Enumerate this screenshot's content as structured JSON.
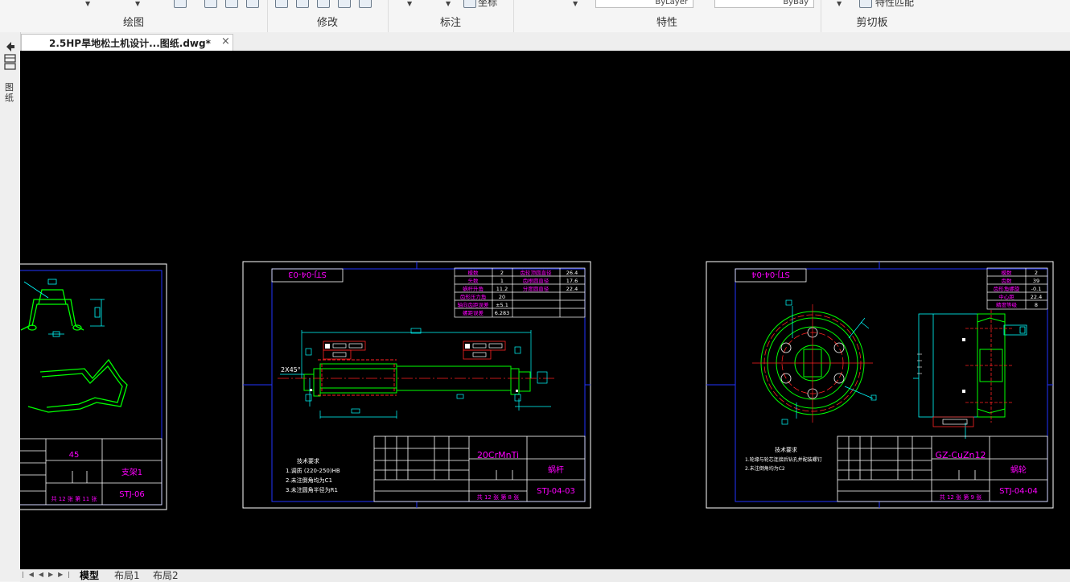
{
  "ribbon": {
    "groups": [
      {
        "label": "绘图"
      },
      {
        "label": "修改"
      },
      {
        "label": "标注"
      },
      {
        "label": "特性"
      },
      {
        "label": "剪切板"
      }
    ],
    "annotate_partial": "坐标",
    "property_values": [
      "ByLayer",
      "ByBay"
    ],
    "match_properties_label": "特性匹配"
  },
  "document_tab": {
    "title": "2.5HP旱地松土机设计...图纸.dwg*",
    "close_symbol": "×"
  },
  "left_panel": {
    "label": "图纸"
  },
  "layout_tabs": [
    {
      "label": "模型",
      "active": true
    },
    {
      "label": "布局1",
      "active": false
    },
    {
      "label": "布局2",
      "active": false
    }
  ],
  "drawing1": {
    "vertical_label": "STJ-04-03",
    "params": [
      [
        "模数",
        "2",
        "齿轮顶圆直径",
        "26.4"
      ],
      [
        "头数",
        "1",
        "齿根圆直径",
        "17.6"
      ],
      [
        "蜗杆升角",
        "11.2",
        "分度圆直径",
        "22.4"
      ],
      [
        "齿形压力角",
        "20",
        "",
        ""
      ],
      [
        "轴向齿距误差",
        "±5.1",
        "",
        ""
      ],
      [
        "螺距误差",
        "6.283",
        "",
        ""
      ]
    ],
    "chamfer": "2X45°",
    "notes_title": "技术要求",
    "notes": [
      "1.调质 (220-250)HB",
      "2.未注倒角均为C1",
      "3.未注圆角半径为R1"
    ],
    "material": "20CrMnTi",
    "part_name": "蜗杆",
    "code": "STJ-04-03",
    "sheet": "共 12 张 第 8 张"
  },
  "drawing2": {
    "vertical_label": "STJ-04-04",
    "params": [
      [
        "模数",
        "2"
      ],
      [
        "齿数",
        "39"
      ],
      [
        "齿形角螺旋",
        "-0.1"
      ],
      [
        "中心距",
        "22.4"
      ],
      [
        "精度等级",
        "8"
      ]
    ],
    "notes_title": "技术要求",
    "notes": [
      "1.轮缘与轮芯连接后钻孔并配装螺钉",
      "2.未注倒角均为C2"
    ],
    "material": "GZ-CuZn12",
    "part_name": "蜗轮",
    "code": "STJ-04-04",
    "sheet": "共 12 张 第 9 张"
  },
  "drawing3": {
    "value": "45",
    "part_name": "支架1",
    "code": "STJ-06",
    "sheet": "共 12 张 第 11 张"
  },
  "colors": {
    "canvas": "#000000",
    "title": "#ff00ff",
    "dim": "#00ffff",
    "frame": "#ffffff",
    "inner_frame": "#0000ff",
    "part": "#00ff00",
    "hidden": "#ff0000"
  }
}
